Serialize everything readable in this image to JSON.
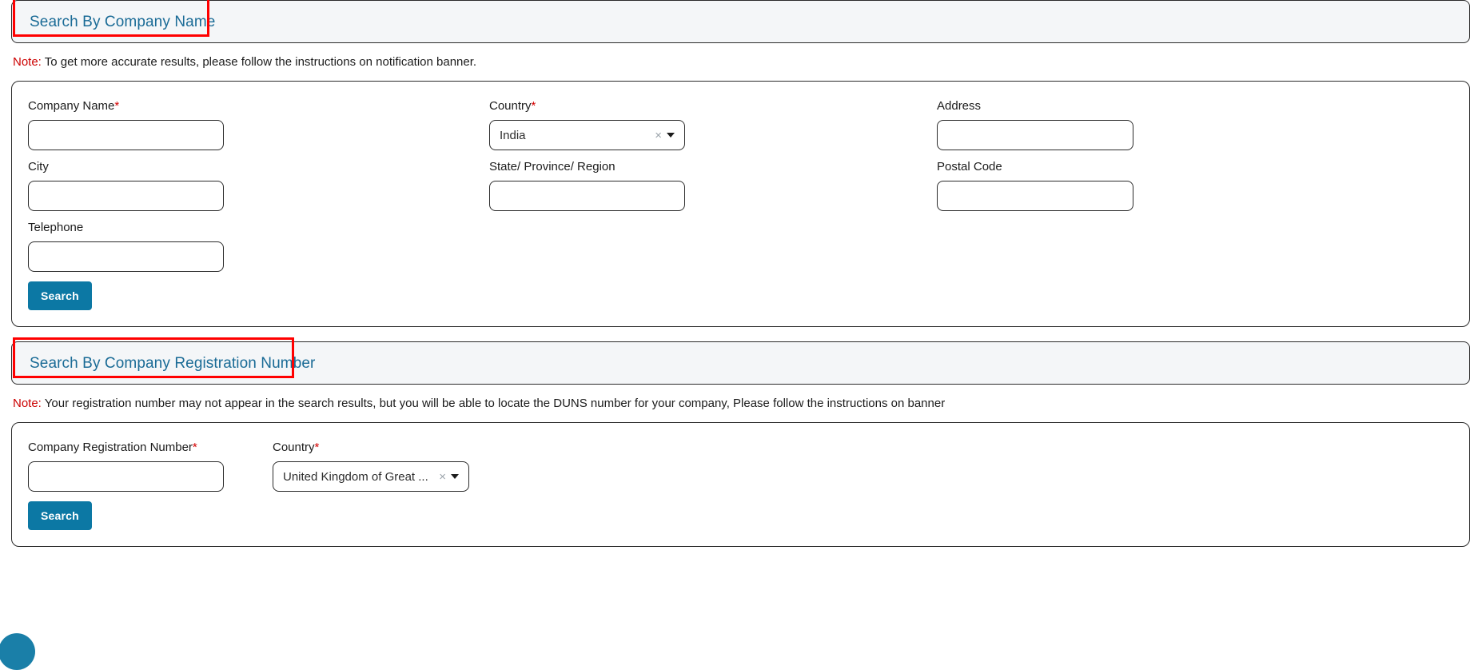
{
  "section1": {
    "header_title": "Search By Company Name",
    "note_label": "Note:",
    "note_text": " To get more accurate results, please follow the instructions on notification banner.",
    "fields": {
      "company_name_label": "Company Name",
      "company_name_value": "",
      "country_label": "Country",
      "country_value": "India",
      "address_label": "Address",
      "address_value": "",
      "city_label": "City",
      "city_value": "",
      "state_label": "State/ Province/ Region",
      "state_value": "",
      "postal_label": "Postal Code",
      "postal_value": "",
      "telephone_label": "Telephone",
      "telephone_value": ""
    },
    "search_button": "Search"
  },
  "section2": {
    "header_title": "Search By Company Registration Number",
    "note_label": "Note:",
    "note_text": " Your registration number may not appear in the search results, but you will be able to locate the DUNS number for your company, Please follow the instructions on banner",
    "fields": {
      "reg_number_label": "Company Registration Number",
      "reg_number_value": "",
      "country_label": "Country",
      "country_value": "United Kingdom of Great ..."
    },
    "search_button": "Search"
  },
  "glyphs": {
    "required_star": "*",
    "clear_x": "×"
  },
  "colors": {
    "accent_button": "#0c78a4",
    "header_title": "#1a6b96",
    "required": "#d40000",
    "note_label": "#cc0000",
    "annotation": "#ff0000",
    "header_bg": "#f4f6f8"
  }
}
